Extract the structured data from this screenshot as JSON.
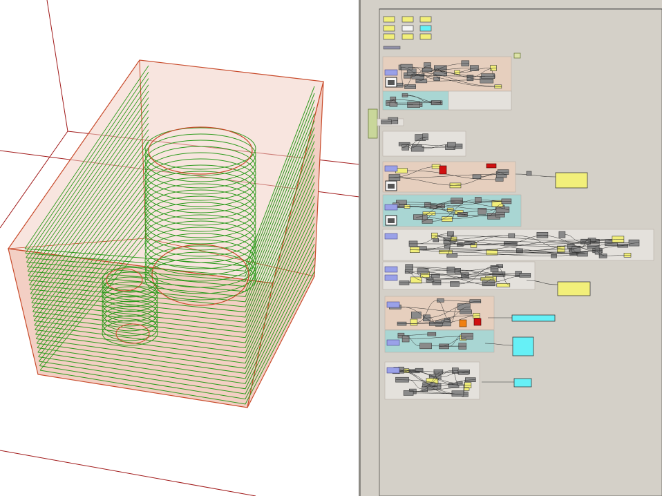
{
  "app": {
    "viewport_name": "rhino-3d-viewport",
    "canvas_name": "grasshopper-canvas"
  },
  "colors": {
    "viewport_bg": "#ffffff",
    "axis_line": "#a01818",
    "box_fill": "#f3cfc4",
    "box_edge": "#c84a2a",
    "contour_green": "#2a9a1a",
    "canvas_bg": "#d4d0c8",
    "group_pink": "#e6cfbe",
    "group_teal": "#a9d6d3",
    "group_grey": "#e4e1dc",
    "panel_yellow": "#f2ef7a",
    "panel_cyan": "#66f0f6",
    "component_grey": "#8a8a8a",
    "param_blue": "#9aa1e8",
    "component_red": "#d01010",
    "component_orange": "#f08010"
  },
  "scene": {
    "contour_count": 28,
    "cylinders": 2,
    "box_count": 1
  },
  "canvas": {
    "group_count": 12,
    "panel_count": 6
  }
}
